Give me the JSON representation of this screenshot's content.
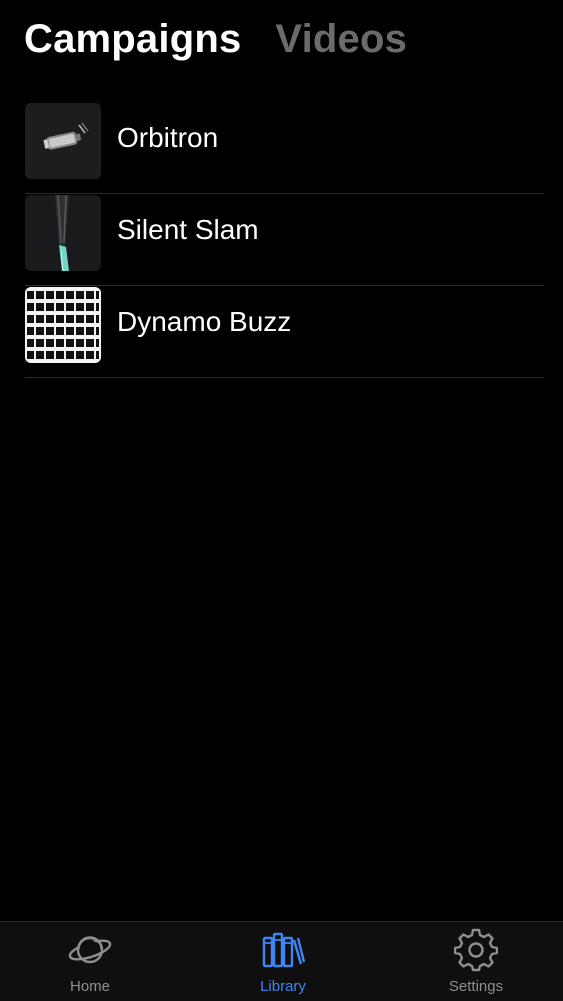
{
  "segments": {
    "campaigns": "Campaigns",
    "videos": "Videos"
  },
  "campaigns": [
    {
      "title": "Orbitron",
      "thumbnail": "bottle-image"
    },
    {
      "title": "Silent Slam",
      "thumbnail": "racket-image"
    },
    {
      "title": "Dynamo Buzz",
      "thumbnail": "grid-pattern-image"
    }
  ],
  "tabbar": {
    "home": {
      "label": "Home",
      "icon": "planet-icon"
    },
    "library": {
      "label": "Library",
      "icon": "books-icon"
    },
    "settings": {
      "label": "Settings",
      "icon": "gear-icon"
    }
  },
  "colors": {
    "background": "#000000",
    "active_tab": "#3f86f2",
    "inactive_tab": "#8e8e93",
    "inactive_segment": "#6b6b6b"
  }
}
